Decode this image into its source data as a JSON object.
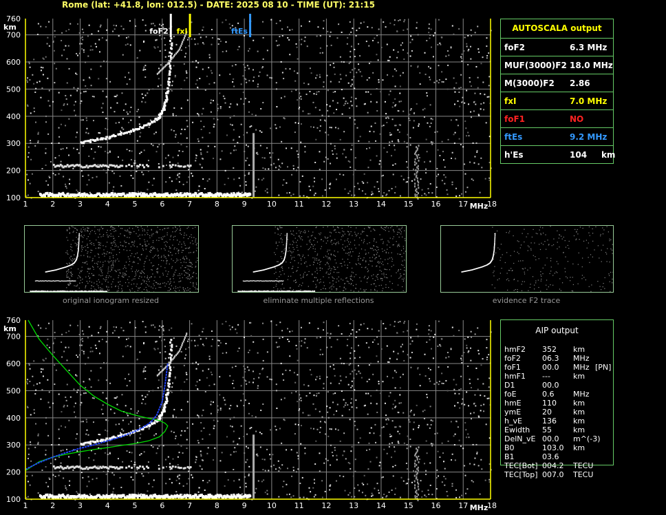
{
  "header": "Rome (lat: +41.8, lon: 012.5) - DATE: 2025 08 10 - TIME (UT): 21:15",
  "colors": {
    "foF2": "#ffffff",
    "fxI": "#ffff00",
    "ftEs": "#3399ff",
    "foF1": "#ff2222",
    "axis": "#ffff00",
    "grid": "#888888",
    "trace": "#00dd00",
    "profile": "#2244ff"
  },
  "chart_data": [
    {
      "type": "scatter",
      "name_id": "main-ionogram",
      "x_unit": "MHz",
      "y_unit": "km",
      "xlim": [
        1,
        18
      ],
      "ylim": [
        100,
        760
      ],
      "x_ticks": [
        "1",
        "2",
        "3",
        "4",
        "5",
        "6",
        "7",
        "8",
        "9",
        "10",
        "11",
        "12",
        "13",
        "14",
        "15",
        "16",
        "17",
        "18"
      ],
      "y_ticks": [
        "100",
        "200",
        "300",
        "400",
        "500",
        "600",
        "700",
        "760"
      ],
      "markers": [
        {
          "label": "foF2",
          "freq": 6.3,
          "color": "#ffffff"
        },
        {
          "label": "fxI",
          "freq": 7.0,
          "color": "#ffff00"
        },
        {
          "label": "ftEs",
          "freq": 9.2,
          "color": "#3399ff"
        }
      ],
      "traces": {
        "es_layer": {
          "freq_range": [
            1.5,
            9.2
          ],
          "height": 115
        },
        "e_second": {
          "freq_range": [
            2.0,
            7.0
          ],
          "height": 220
        },
        "f2_trace": {
          "x": [
            3.0,
            3.5,
            4.0,
            4.5,
            5.0,
            5.5,
            5.8,
            6.0,
            6.1,
            6.2,
            6.25,
            6.3
          ],
          "y": [
            305,
            315,
            325,
            340,
            355,
            375,
            395,
            425,
            460,
            520,
            600,
            700
          ]
        },
        "f2_second": {
          "x": [
            5.8,
            6.2,
            6.6,
            6.9
          ],
          "y": [
            560,
            600,
            650,
            720
          ]
        }
      }
    },
    {
      "type": "scatter",
      "name_id": "aip-ionogram",
      "x_unit": "MHz",
      "y_unit": "km",
      "xlim": [
        1,
        18
      ],
      "ylim": [
        100,
        760
      ],
      "x_ticks": [
        "1",
        "2",
        "3",
        "4",
        "5",
        "6",
        "7",
        "8",
        "9",
        "10",
        "11",
        "12",
        "13",
        "14",
        "15",
        "16",
        "17",
        "18"
      ],
      "y_ticks": [
        "100",
        "200",
        "300",
        "400",
        "500",
        "600",
        "700",
        "760"
      ],
      "green_trace": {
        "x": [
          1.1,
          1.5,
          2,
          2.5,
          3,
          3.5,
          4,
          4.5,
          5,
          5.5,
          5.9,
          6.1,
          6.2,
          6.1,
          5.9,
          5.5,
          5,
          4.5,
          4,
          3.5,
          3,
          2.5,
          2,
          1.5,
          1.0
        ],
        "y": [
          760,
          690,
          630,
          575,
          520,
          480,
          450,
          425,
          410,
          398,
          390,
          380,
          370,
          350,
          330,
          315,
          305,
          298,
          290,
          283,
          275,
          266,
          255,
          238,
          205
        ]
      },
      "blue_profile": {
        "x": [
          1.0,
          1.5,
          2,
          2.5,
          3,
          3.5,
          4,
          4.5,
          5,
          5.3,
          5.6,
          5.8,
          6.0,
          6.1,
          6.2
        ],
        "y": [
          210,
          235,
          255,
          272,
          288,
          300,
          315,
          330,
          350,
          365,
          385,
          410,
          460,
          520,
          600
        ]
      }
    }
  ],
  "thumbnails": [
    {
      "caption": "original ionogram resized"
    },
    {
      "caption": "eliminate multiple reflections"
    },
    {
      "caption": "evidence F2 trace"
    }
  ],
  "autoscala": {
    "title": "AUTOSCALA output",
    "rows": [
      {
        "label": "foF2",
        "value": "6.3 MHz",
        "color": "#ffffff"
      },
      {
        "label": "MUF(3000)F2",
        "value": "18.0 MHz",
        "color": "#ffffff"
      },
      {
        "label": "M(3000)F2",
        "value": "2.86",
        "color": "#ffffff"
      },
      {
        "label": "fxI",
        "value": "7.0 MHz",
        "color": "#ffff00"
      },
      {
        "label": "foF1",
        "value": "NO",
        "color": "#ff2222"
      },
      {
        "label": "ftEs",
        "value": "9.2 MHz",
        "color": "#3399ff"
      },
      {
        "label": "h'Es",
        "value": "104     km",
        "color": "#ffffff"
      }
    ]
  },
  "aip": {
    "title": "AIP output",
    "rows": [
      {
        "param": "hmF2",
        "value": "352",
        "unit": "km",
        "flag": ""
      },
      {
        "param": "foF2",
        "value": "06.3",
        "unit": "MHz",
        "flag": ""
      },
      {
        "param": "foF1",
        "value": "00.0",
        "unit": "MHz",
        "flag": "[PN]"
      },
      {
        "param": "hmF1",
        "value": "---",
        "unit": "km",
        "flag": ""
      },
      {
        "param": "D1",
        "value": "00.0",
        "unit": "",
        "flag": ""
      },
      {
        "param": "foE",
        "value": "0.6",
        "unit": "MHz",
        "flag": ""
      },
      {
        "param": "hmE",
        "value": "110",
        "unit": "km",
        "flag": ""
      },
      {
        "param": "ymE",
        "value": "20",
        "unit": "km",
        "flag": ""
      },
      {
        "param": "h_vE",
        "value": "136",
        "unit": "km",
        "flag": ""
      },
      {
        "param": "Ewidth",
        "value": "55",
        "unit": "km",
        "flag": ""
      },
      {
        "param": "DelN_vE",
        "value": "00.0",
        "unit": "m^(-3)",
        "flag": ""
      },
      {
        "param": "B0",
        "value": "103.0",
        "unit": "km",
        "flag": ""
      },
      {
        "param": "B1",
        "value": "03.6",
        "unit": "",
        "flag": ""
      },
      {
        "param": "TEC[Bot]",
        "value": "004.2",
        "unit": "TECU",
        "flag": ""
      },
      {
        "param": "TEC[Top]",
        "value": "007.0",
        "unit": "TECU",
        "flag": ""
      }
    ]
  }
}
